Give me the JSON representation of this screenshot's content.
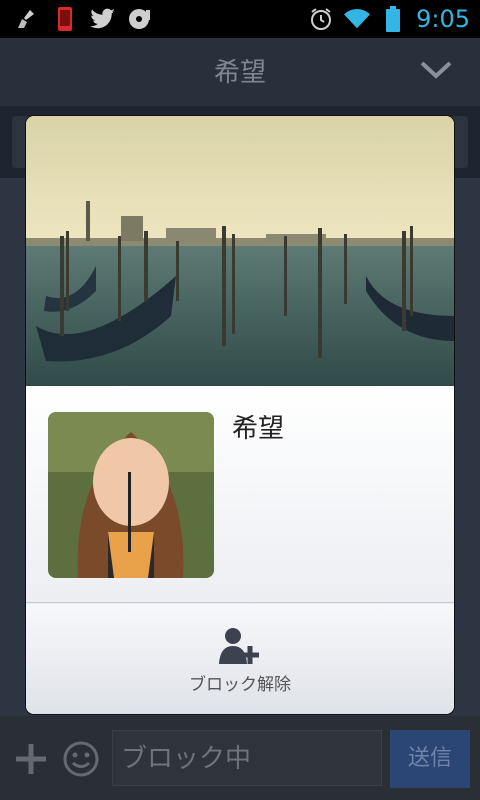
{
  "status_bar": {
    "time": "9:05",
    "left_icons": [
      "broom-icon",
      "phone-icon",
      "twitter-icon",
      "rec-disc-icon"
    ],
    "right_icons": [
      "alarm-icon",
      "wifi-icon",
      "battery-icon"
    ]
  },
  "header": {
    "title": "希望",
    "collapse_icon": "chevron-down-icon"
  },
  "dialog": {
    "name": "希望",
    "unblock_label": "ブロック解除",
    "unblock_icon": "add-person-icon"
  },
  "input_bar": {
    "placeholder": "ブロック中",
    "send_label": "送信",
    "plus_icon": "plus-icon",
    "emoji_icon": "smiley-icon"
  },
  "colors": {
    "time": "#33b5e5",
    "send_bg": "#2b4575",
    "header_bg": "#2a303b"
  }
}
